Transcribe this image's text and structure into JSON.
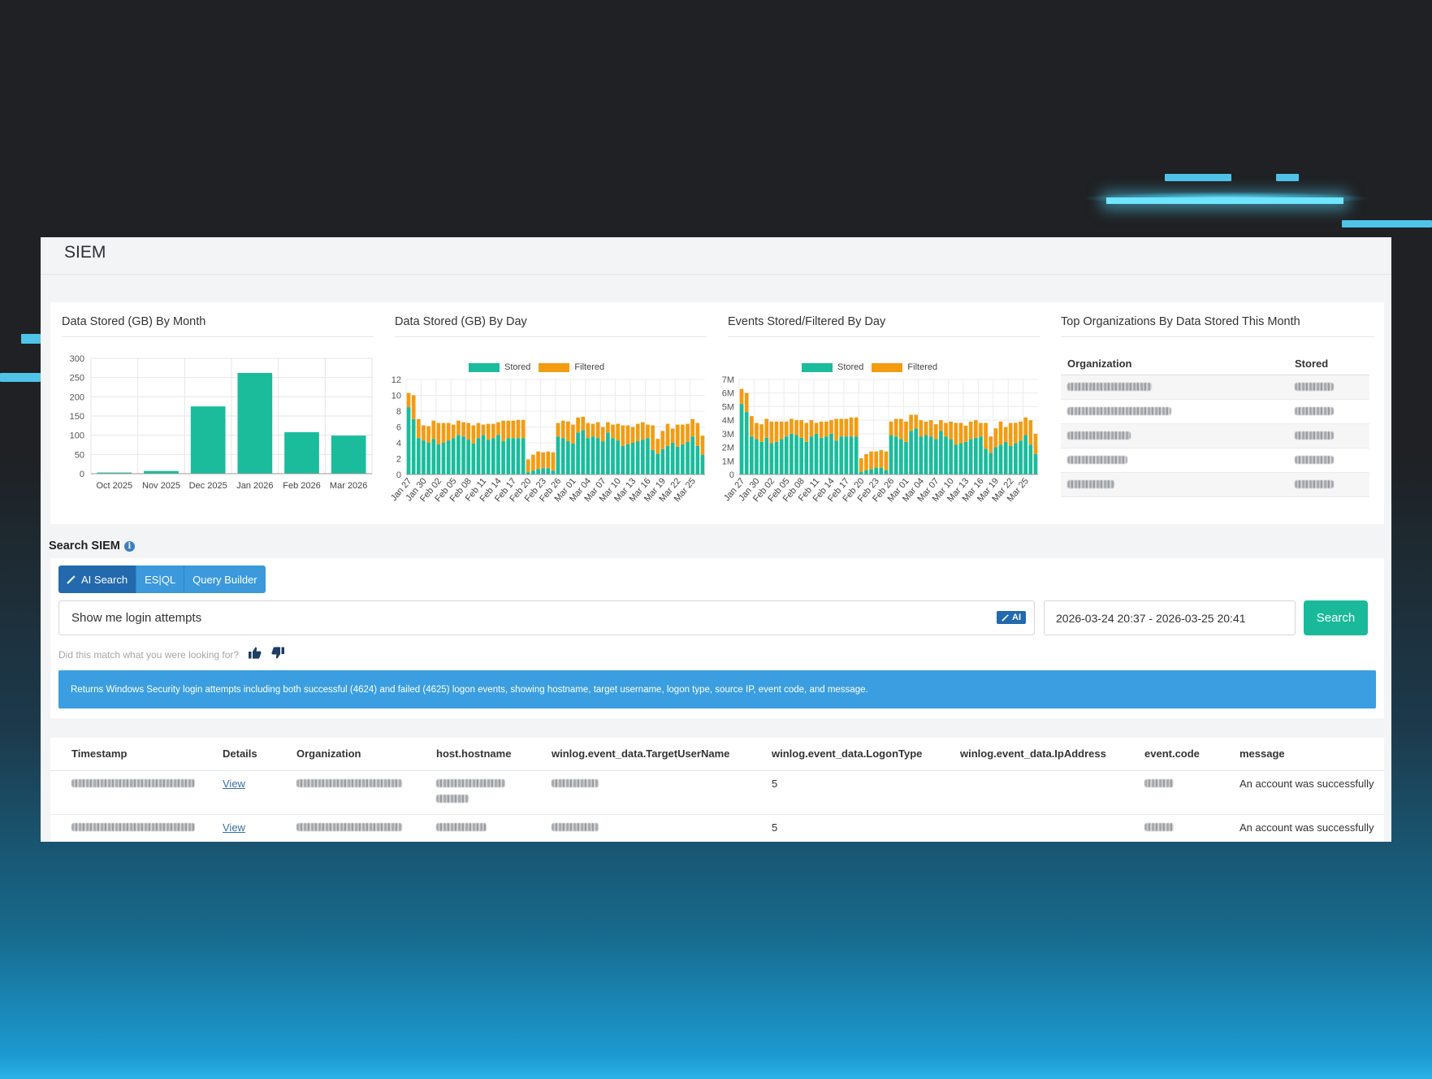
{
  "app": {
    "title": "SIEM"
  },
  "colors": {
    "stored": "#1abc9c",
    "filtered": "#f39c12",
    "primary": "#3b99dc",
    "active_tab": "#2369ad",
    "search_button": "#1ab99a",
    "banner": "#3a9ee0"
  },
  "charts": {
    "by_month_title": "Data Stored (GB) By Month",
    "by_day_title": "Data Stored (GB) By Day",
    "events_title": "Events Stored/Filtered By Day",
    "legend_stored": "Stored",
    "legend_filtered": "Filtered"
  },
  "chart_data": [
    {
      "type": "bar",
      "title": "Data Stored (GB) By Month",
      "categories": [
        "Oct 2025",
        "Nov 2025",
        "Dec 2025",
        "Jan 2026",
        "Feb 2026",
        "Mar 2026"
      ],
      "values": [
        3,
        7,
        175,
        262,
        108,
        99
      ],
      "ylim": [
        0,
        300
      ],
      "yticks": [
        "0",
        "50",
        "100",
        "150",
        "200",
        "250",
        "300"
      ],
      "grid": true
    },
    {
      "type": "bar",
      "stacked": true,
      "title": "Data Stored (GB) By Day",
      "x_tick_labels": [
        "Jan 27",
        "Jan 30",
        "Feb 02",
        "Feb 05",
        "Feb 08",
        "Feb 11",
        "Feb 14",
        "Feb 17",
        "Feb 20",
        "Feb 23",
        "Feb 26",
        "Mar 01",
        "Mar 04",
        "Mar 07",
        "Mar 10",
        "Mar 13",
        "Mar 16",
        "Mar 19",
        "Mar 22",
        "Mar 25"
      ],
      "ylim": [
        0,
        12
      ],
      "yticks": [
        "0",
        "2",
        "4",
        "6",
        "8",
        "10",
        "12"
      ],
      "legend": "top",
      "series": [
        {
          "name": "Stored",
          "values": [
            8.5,
            7.0,
            4.6,
            4.3,
            4.0,
            4.5,
            3.8,
            4.0,
            4.3,
            4.6,
            5.0,
            4.8,
            4.4,
            3.9,
            4.6,
            5.0,
            4.4,
            4.6,
            5.0,
            4.2,
            4.6,
            4.6,
            4.6,
            4.6,
            0.3,
            0.5,
            0.7,
            0.8,
            0.8,
            0.5,
            4.8,
            4.6,
            4.2,
            3.9,
            5.3,
            5.6,
            4.6,
            4.8,
            4.6,
            4.2,
            5.3,
            4.6,
            4.3,
            3.6,
            3.8,
            4.0,
            4.2,
            4.4,
            4.6,
            3.1,
            2.6,
            3.2,
            3.6,
            4.0,
            3.5,
            3.8,
            4.1,
            4.8,
            3.6,
            2.5
          ]
        },
        {
          "name": "Filtered",
          "values": [
            1.8,
            3.0,
            2.4,
            1.9,
            2.1,
            2.3,
            2.7,
            2.5,
            2.2,
            1.7,
            1.8,
            1.8,
            2.1,
            2.3,
            1.9,
            1.3,
            2.0,
            1.8,
            1.6,
            2.6,
            2.2,
            2.2,
            2.3,
            2.3,
            1.6,
            2.0,
            2.2,
            2.0,
            2.1,
            2.3,
            1.7,
            2.2,
            2.5,
            2.4,
            1.9,
            1.7,
            1.9,
            1.6,
            2.0,
            1.8,
            1.3,
            1.7,
            2.1,
            2.6,
            2.4,
            2.0,
            2.2,
            2.2,
            1.7,
            3.1,
            1.9,
            2.3,
            2.8,
            1.8,
            2.8,
            2.5,
            2.3,
            2.2,
            2.9,
            2.4
          ]
        }
      ]
    },
    {
      "type": "bar",
      "stacked": true,
      "title": "Events Stored/Filtered By Day",
      "x_tick_labels": [
        "Jan 27",
        "Jan 30",
        "Feb 02",
        "Feb 05",
        "Feb 08",
        "Feb 11",
        "Feb 14",
        "Feb 17",
        "Feb 20",
        "Feb 23",
        "Feb 26",
        "Mar 01",
        "Mar 04",
        "Mar 07",
        "Mar 10",
        "Mar 13",
        "Mar 16",
        "Mar 19",
        "Mar 22",
        "Mar 25"
      ],
      "ylim": [
        0,
        7000000
      ],
      "yticks": [
        "0",
        "1M",
        "2M",
        "3M",
        "4M",
        "5M",
        "6M",
        "7M"
      ],
      "legend": "top",
      "series": [
        {
          "name": "Stored",
          "values": [
            5200000,
            4600000,
            2800000,
            2600000,
            2400000,
            2700000,
            2300000,
            2400000,
            2600000,
            2800000,
            3000000,
            2900000,
            2700000,
            2400000,
            2800000,
            3000000,
            2700000,
            2800000,
            3000000,
            2500000,
            2800000,
            2800000,
            2800000,
            2800000,
            200000,
            300000,
            400000,
            500000,
            500000,
            300000,
            2900000,
            2800000,
            2600000,
            2400000,
            3200000,
            3400000,
            2800000,
            2900000,
            2800000,
            2600000,
            3200000,
            2800000,
            2600000,
            2200000,
            2300000,
            2400000,
            2600000,
            2700000,
            2800000,
            1900000,
            1600000,
            2000000,
            2200000,
            2400000,
            2100000,
            2300000,
            2500000,
            2900000,
            2200000,
            1500000
          ]
        },
        {
          "name": "Filtered",
          "values": [
            1100000,
            1400000,
            1500000,
            1200000,
            1300000,
            1400000,
            1600000,
            1500000,
            1300000,
            1100000,
            1100000,
            1100000,
            1300000,
            1400000,
            1200000,
            800000,
            1200000,
            1100000,
            1000000,
            1600000,
            1300000,
            1300000,
            1400000,
            1400000,
            1000000,
            1200000,
            1300000,
            1200000,
            1300000,
            1400000,
            1000000,
            1300000,
            1500000,
            1500000,
            1200000,
            1000000,
            1200000,
            1000000,
            1200000,
            1100000,
            800000,
            1000000,
            1300000,
            1600000,
            1500000,
            1200000,
            1300000,
            1300000,
            1000000,
            1900000,
            1200000,
            1400000,
            1700000,
            1100000,
            1700000,
            1500000,
            1400000,
            1300000,
            1800000,
            1500000
          ]
        }
      ]
    }
  ],
  "top_orgs": {
    "title": "Top Organizations By Data Stored This Month",
    "columns": [
      "Organization",
      "Stored"
    ]
  },
  "search": {
    "heading": "Search SIEM",
    "tabs": [
      "AI Search",
      "ES|QL",
      "Query Builder"
    ],
    "query_value": "Show me login attempts",
    "ai_badge": "AI",
    "date_range": "2026-03-24 20:37 - 2026-03-25 20:41",
    "button_label": "Search",
    "feedback_prompt": "Did this match what you were looking for?",
    "description": "Returns Windows Security login attempts including both successful (4624) and failed (4625) logon events, showing hostname, target username, logon type, source IP, event code, and message."
  },
  "results": {
    "columns": [
      "Timestamp",
      "Details",
      "Organization",
      "host.hostname",
      "winlog.event_data.TargetUserName",
      "winlog.event_data.LogonType",
      "winlog.event_data.IpAddress",
      "event.code",
      "message"
    ],
    "rows": [
      {
        "details": "View",
        "logon_type": "5",
        "message": "An account was successfully"
      },
      {
        "details": "View",
        "logon_type": "5",
        "message": "An account was successfully"
      }
    ]
  }
}
